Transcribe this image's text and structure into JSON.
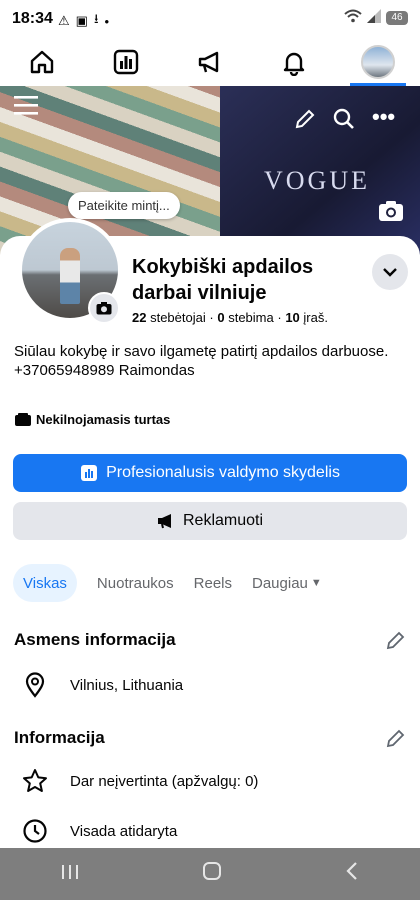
{
  "status_bar": {
    "time": "18:34",
    "battery": "46"
  },
  "top_nav": {
    "items": [
      {
        "name": "home",
        "icon": "home-icon"
      },
      {
        "name": "dashboard",
        "icon": "bar-chart-icon"
      },
      {
        "name": "ads",
        "icon": "megaphone-icon"
      },
      {
        "name": "notifications",
        "icon": "bell-icon"
      },
      {
        "name": "profile",
        "icon": "avatar"
      }
    ]
  },
  "cover": {
    "magazine_text": "VOGUE"
  },
  "thought_bubble": "Pateikite mintį...",
  "profile": {
    "name": "Kokybiški apdailos darbai vilniuje",
    "followers_count": "22",
    "followers_label": "stebėtojai",
    "following_count": "0",
    "following_label": "stebima",
    "posts_count": "10",
    "posts_label": "įraš.",
    "bio_line1": "Siūlau kokybę ir savo ilgametę patirtį apdailos darbuose.",
    "bio_line2": "+37065948989 Raimondas",
    "category": "Nekilnojamasis turtas"
  },
  "buttons": {
    "dashboard": "Profesionalusis valdymo skydelis",
    "advertise": "Reklamuoti"
  },
  "tabs": [
    "Viskas",
    "Nuotraukos",
    "Reels",
    "Daugiau"
  ],
  "personal_info": {
    "title": "Asmens informacija",
    "location": "Vilnius, Lithuania"
  },
  "info": {
    "title": "Informacija",
    "rating": "Dar neįvertinta (apžvalgų: 0)",
    "hours": "Visada atidaryta"
  },
  "colors": {
    "accent": "#1877f2",
    "tab_bg": "#e7f3ff",
    "secondary_bg": "#e4e6eb"
  }
}
